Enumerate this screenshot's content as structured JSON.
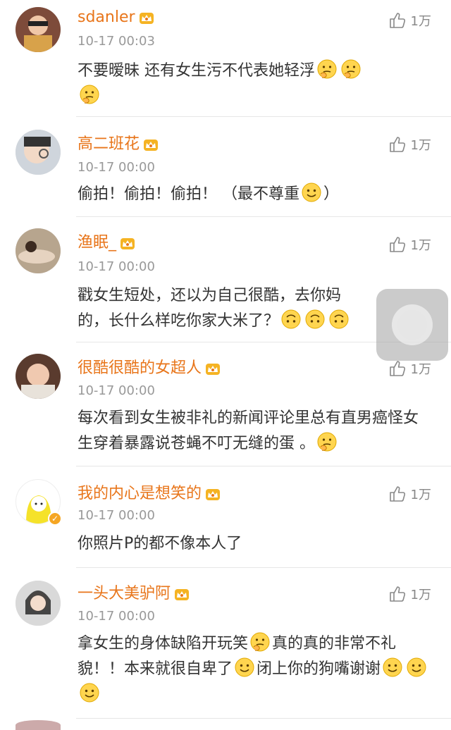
{
  "like_count": "1万",
  "comments": [
    {
      "name": "sdanler",
      "time": "10-17 00:03",
      "text": "不要暧昧  还有女生污不代表她轻浮",
      "trailing_emojis": [
        "thinking",
        "thinking",
        "thinking"
      ]
    },
    {
      "name": "高二班花",
      "time": "10-17 00:00",
      "text": "偷拍！偷拍！偷拍！ （最不尊重",
      "trailing_emojis": [
        "smile"
      ],
      "text_after": "）"
    },
    {
      "name": "渔眠_",
      "time": "10-17 00:00",
      "text": "戳女生短处，还以为自己很酷，去你妈的，长什么样吃你家大米了？",
      "trailing_emojis": [
        "upside",
        "upside",
        "upside"
      ]
    },
    {
      "name": "很酷很酷的女超人",
      "time": "10-17 00:00",
      "text": "每次看到女生被非礼的新闻评论里总有直男癌怪女生穿着暴露说苍蝇不叮无缝的蛋  。",
      "trailing_emojis": [
        "thinking"
      ]
    },
    {
      "name": "我的内心是想笑的",
      "time": "10-17 00:00",
      "text": "你照片P的都不像本人了",
      "trailing_emojis": []
    },
    {
      "name": "一头大美驴阿",
      "time": "10-17 00:00",
      "text": "拿女生的身体缺陷开玩笑",
      "text_mid": "真的真的非常不礼貌！！本来就很自卑了",
      "text_mid2": "闭上你的狗嘴谢谢",
      "trailing_emojis": [
        "smile",
        "smile",
        "smile"
      ]
    }
  ],
  "colors": {
    "name": "#e8751a",
    "time": "#999999",
    "text": "#333333"
  },
  "icons": [
    "thumb-up-icon",
    "crown-badge-icon",
    "verified-badge-icon"
  ]
}
